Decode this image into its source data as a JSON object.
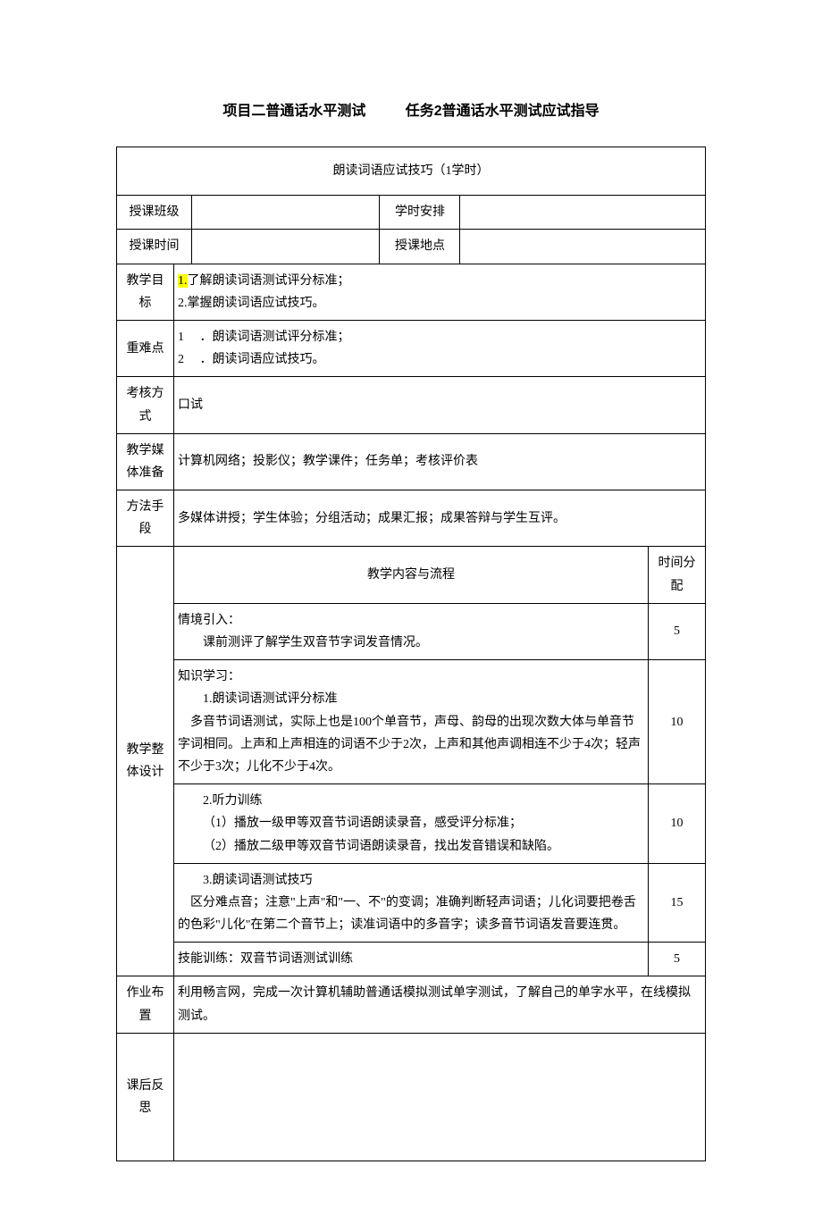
{
  "header": {
    "title_left": "项目二普通话水平测试",
    "title_right": "任务2普通话水平测试应试指导"
  },
  "table": {
    "lesson_title": "朗读词语应试技巧（1学时）",
    "row_labels": {
      "class": "授课班级",
      "schedule": "学时安排",
      "time": "授课时间",
      "location": "授课地点",
      "goal": "教学目标",
      "keypoints": "重难点",
      "assess": "考核方式",
      "media": "教学媒体准备",
      "method": "方法手段",
      "design": "教学整体设计",
      "homework": "作业布置",
      "reflect": "课后反思"
    },
    "goal": {
      "line1_marker": "1.",
      "line1": "了解朗读词语测试评分标准；",
      "line2": "2.掌握朗读词语应试技巧。"
    },
    "keypoints": {
      "item1_num": "1",
      "item1_text": "．朗读词语测试评分标准；",
      "item2_num": "2",
      "item2_text": "．朗读词语应试技巧。"
    },
    "assess": "口试",
    "media": "计算机网络；投影仪；教学课件；任务单；考核评价表",
    "method": "多媒体讲授；学生体验；分组活动；成果汇报；成果答辩与学生互评。",
    "flow": {
      "header_content": "教学内容与流程",
      "header_time": "时间分配",
      "rows": [
        {
          "content_title": "情境引入：",
          "content_body": "课前测评了解学生双音节字词发音情况。",
          "time": "5"
        },
        {
          "content_title": "知识学习：",
          "content_sub": "1.朗读词语测试评分标准",
          "content_body": "多音节词语测试，实际上也是100个单音节，声母、韵母的出现次数大体与单音节字词相同。上声和上声相连的词语不少于2次，上声和其他声调相连不少于4次；轻声不少于3次；儿化不少于4次。",
          "time": "10"
        },
        {
          "content_sub": "2.听力训练",
          "content_line1": "（1）播放一级甲等双音节词语朗读录音，感受评分标准；",
          "content_line2": "（2）播放二级甲等双音节词语朗读录音，找出发音错误和缺陷。",
          "time": "10"
        },
        {
          "content_sub": "3.朗读词语测试技巧",
          "content_body": "区分难点音；注意\"上声\"和\"一、不\"的变调；准确判断轻声词语；儿化词要把卷舌的色彩\"儿化\"在第二个音节上；读准词语中的多音字；读多音节词语发音要连贯。",
          "time": "15"
        },
        {
          "content_body": "技能训练：双音节词语测试训练",
          "time": "5"
        }
      ]
    },
    "homework": "利用畅言网，完成一次计算机辅助普通话模拟测试单字测试，了解自己的单字水平，在线模拟测试。",
    "reflect": ""
  }
}
